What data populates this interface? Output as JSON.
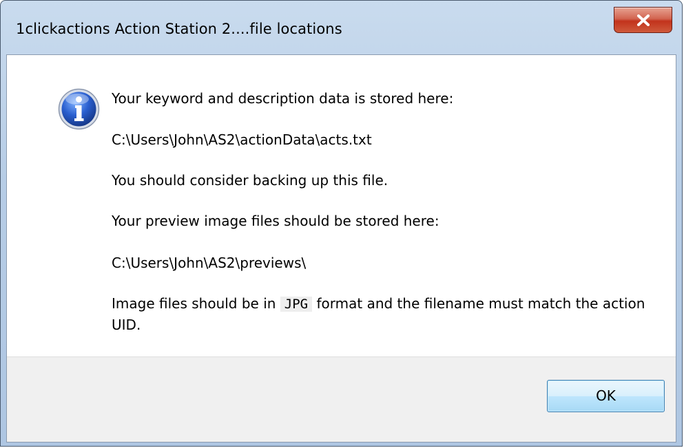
{
  "window": {
    "title": "1clickactions Action Station 2....file locations"
  },
  "message": {
    "icon": "info-icon",
    "line1": "Your keyword and description data is stored here:",
    "data_path": "C:\\Users\\John\\AS2\\actionData\\acts.txt",
    "line3": "You should consider backing up this file.",
    "line4": "Your preview image files should be stored here:",
    "previews_path": "C:\\Users\\John\\AS2\\previews\\",
    "line6_prefix": "Image files should be in",
    "line6_format": "JPG",
    "line6_suffix": "format and the filename must match the action UID."
  },
  "buttons": {
    "ok_label": "OK",
    "close_icon": "close-icon"
  },
  "colors": {
    "close_button": "#c2331c",
    "ok_button_border": "#3c7fb1",
    "info_icon": "#1f4fb5"
  }
}
